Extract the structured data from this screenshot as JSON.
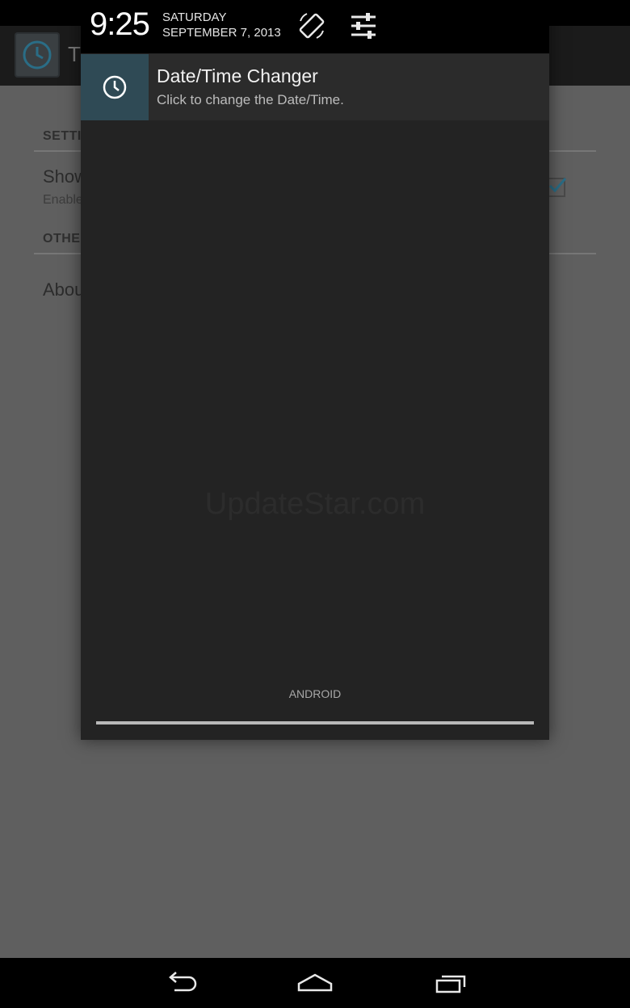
{
  "background_app": {
    "title": "Ti",
    "settings_header": "SETTI",
    "show_pref_title": "Show in notification bar",
    "show_pref_sub": "Enable",
    "others_header": "OTHE",
    "about_label": "About"
  },
  "status": {
    "time": "9:25",
    "day": "SATURDAY",
    "date": "SEPTEMBER 7, 2013"
  },
  "notification": {
    "title": "Date/Time Changer",
    "text": "Click to change the Date/Time.",
    "icon": "clock-icon"
  },
  "carrier": "ANDROID",
  "watermark": "UpdateStar.com",
  "icons": {
    "rotate": "auto-rotate-icon",
    "settings": "quick-settings-icon",
    "back": "back-icon",
    "home": "home-icon",
    "recents": "recent-apps-icon"
  },
  "colors": {
    "notification_icon_bg": "#2f4a55",
    "shade_bg": "#232323",
    "checkbox_accent": "#33b5e5"
  }
}
